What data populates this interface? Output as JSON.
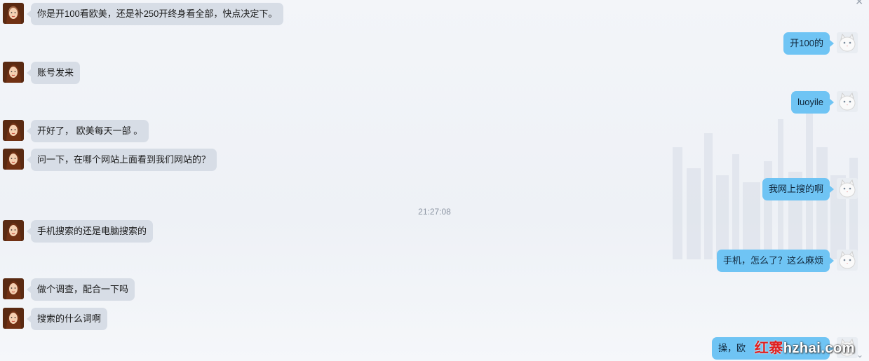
{
  "messages": [
    {
      "side": "left",
      "text": "你是开100看欧美，还是补250开终身看全部，快点决定下。"
    },
    {
      "side": "right",
      "text": "开100的"
    },
    {
      "side": "left",
      "text": "账号发来"
    },
    {
      "side": "right",
      "text": "luoyile"
    },
    {
      "side": "left",
      "text": "开好了， 欧美每天一部 。"
    },
    {
      "side": "left",
      "text": "问一下，在哪个网站上面看到我们网站的？"
    },
    {
      "side": "right",
      "text": "我网上搜的啊"
    },
    {
      "side": "left",
      "text": "手机搜索的还是电脑搜索的"
    },
    {
      "side": "right",
      "text": "手机，怎么了？这么麻烦"
    },
    {
      "side": "left",
      "text": "做个调查，配合一下吗"
    },
    {
      "side": "left",
      "text": "搜索的什么词啊"
    },
    {
      "side": "right",
      "text": "操，欧"
    }
  ],
  "timestamp": "21:27:08",
  "controls": {
    "close_icon": "✕",
    "scroll_icon": "⌄"
  },
  "watermark": {
    "cn": "红寨",
    "en": "hzhai.com"
  },
  "colors": {
    "left_bubble": "#d7dde6",
    "right_bubble": "#6fc4f4"
  }
}
